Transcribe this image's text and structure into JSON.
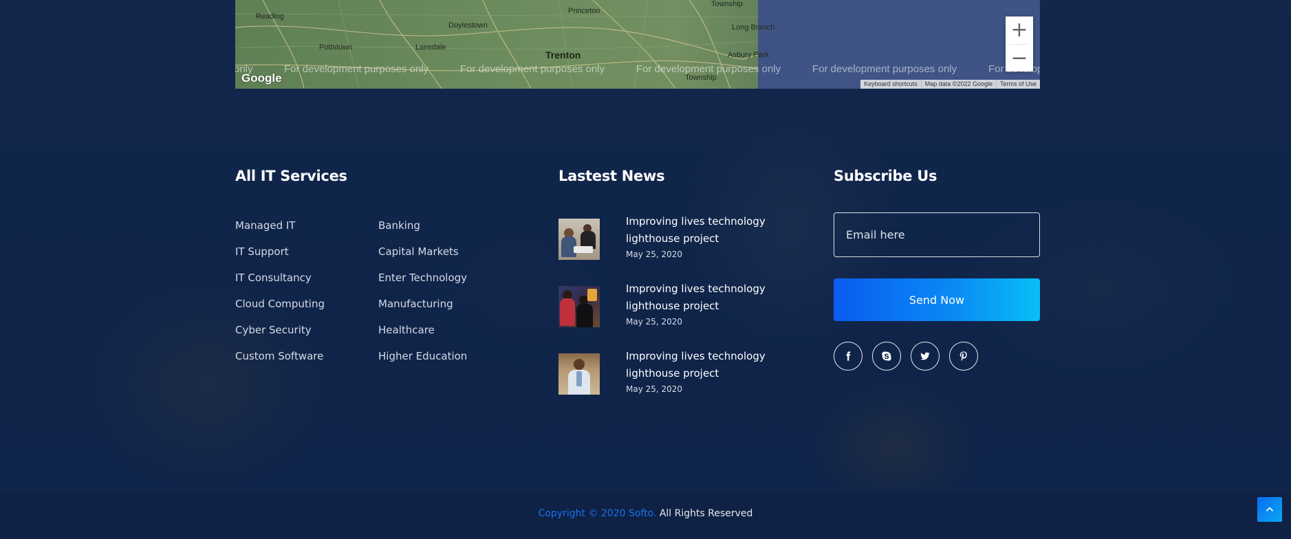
{
  "map": {
    "places": [
      "Reading",
      "Princeton",
      "Township",
      "Doylestown",
      "Long Branch",
      "Pottstown",
      "Lansdale",
      "Trenton",
      "Asbury Park",
      "Township"
    ],
    "dev_notice": "For development purposes only",
    "dev_notice_partial_left": "only",
    "dev_notice_partial_right": "For develop",
    "logo": "Google",
    "attribution": [
      "Keyboard shortcuts",
      "Map data ©2022 Google",
      "Terms of Use"
    ],
    "zoom_in": "+",
    "zoom_out": "−"
  },
  "services": {
    "title": "All IT Services",
    "col1": [
      "Managed IT",
      "IT Support",
      "IT Consultancy",
      "Cloud Computing",
      "Cyber Security",
      "Custom Software"
    ],
    "col2": [
      "Banking",
      "Capital Markets",
      "Enter Technology",
      "Manufacturing",
      "Healthcare",
      "Higher Education"
    ]
  },
  "news": {
    "title": "Lastest News",
    "items": [
      {
        "title": "Improving lives technology lighthouse project",
        "date": "May 25, 2020"
      },
      {
        "title": "Improving lives technology lighthouse project",
        "date": "May 25, 2020"
      },
      {
        "title": "Improving lives technology lighthouse project",
        "date": "May 25, 2020"
      }
    ]
  },
  "subscribe": {
    "title": "Subscribe Us",
    "email_placeholder": "Email here",
    "button": "Send Now",
    "socials": [
      "facebook-icon",
      "skype-icon",
      "twitter-icon",
      "pinterest-icon"
    ]
  },
  "footer": {
    "copyright_brand": "Copyright © 2020 Softo.",
    "copyright_rest": " All Rights Reserved"
  },
  "colors": {
    "accent": "#1574f3",
    "button_gradient_start": "#0a5cf0",
    "button_gradient_end": "#08bff7",
    "background": "#0e2140"
  }
}
